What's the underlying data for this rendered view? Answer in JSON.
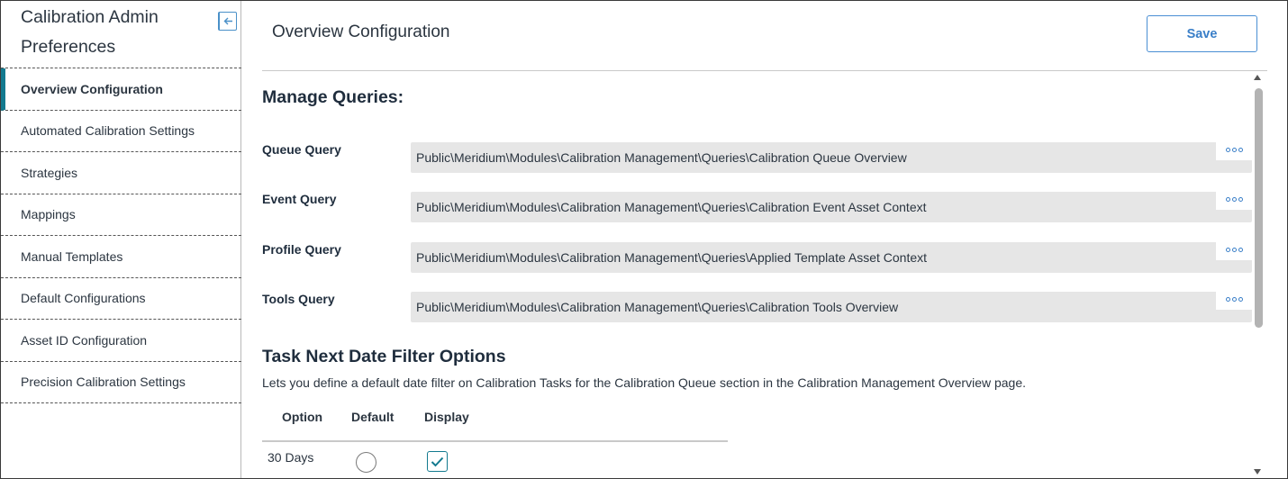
{
  "sidebar": {
    "title_line1": "Calibration Admin",
    "title_line2": "Preferences",
    "collapse_icon": "collapse-left-icon",
    "items": [
      {
        "label": "Overview Configuration",
        "active": true
      },
      {
        "label": "Automated Calibration Settings"
      },
      {
        "label": "Strategies"
      },
      {
        "label": "Mappings"
      },
      {
        "label": "Manual Templates"
      },
      {
        "label": "Default Configurations"
      },
      {
        "label": "Asset ID Configuration"
      },
      {
        "label": "Precision Calibration Settings"
      }
    ]
  },
  "header": {
    "title": "Overview Configuration",
    "save_label": "Save"
  },
  "manage_queries": {
    "heading": "Manage Queries:",
    "rows": [
      {
        "label": "Queue Query",
        "value": "Public\\Meridium\\Modules\\Calibration Management\\Queries\\Calibration Queue Overview"
      },
      {
        "label": "Event Query",
        "value": "Public\\Meridium\\Modules\\Calibration Management\\Queries\\Calibration Event Asset Context"
      },
      {
        "label": "Profile Query",
        "value": "Public\\Meridium\\Modules\\Calibration Management\\Queries\\Applied Template Asset Context"
      },
      {
        "label": "Tools Query",
        "value": "Public\\Meridium\\Modules\\Calibration Management\\Queries\\Calibration Tools Overview"
      }
    ],
    "more_icon": "more-options-icon"
  },
  "task_filter": {
    "heading": "Task Next Date Filter Options",
    "description": "Lets you define a default date filter on Calibration Tasks for the Calibration Queue section in the Calibration Management Overview page.",
    "columns": [
      "Option",
      "Default",
      "Display"
    ],
    "rows": [
      {
        "option": "30 Days",
        "default": false,
        "display": true
      }
    ]
  },
  "colors": {
    "accent": "#137a8f",
    "link": "#3a7fc8",
    "field_bg": "#e6e6e6"
  }
}
